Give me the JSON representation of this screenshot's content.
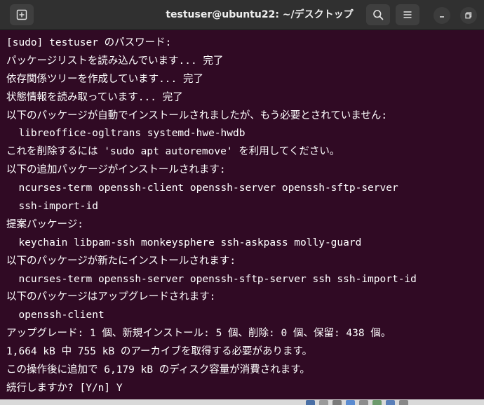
{
  "window": {
    "title": "testuser@ubuntu22: ~/デスクトップ"
  },
  "icons": {
    "new_tab": "new-tab-icon",
    "search": "search-icon",
    "menu": "hamburger-menu-icon",
    "minimize": "minimize-icon",
    "maximize": "maximize-icon"
  },
  "colors": {
    "terminal_bg": "#300a24",
    "header_bg": "#303030",
    "text": "#ffffff"
  },
  "terminal": {
    "lines": [
      "[sudo] testuser のパスワード:",
      "パッケージリストを読み込んでいます... 完了",
      "依存関係ツリーを作成しています... 完了",
      "状態情報を読み取っています... 完了",
      "以下のパッケージが自動でインストールされましたが、もう必要とされていません:",
      "  libreoffice-ogltrans systemd-hwe-hwdb",
      "これを削除するには 'sudo apt autoremove' を利用してください。",
      "以下の追加パッケージがインストールされます:",
      "  ncurses-term openssh-client openssh-server openssh-sftp-server",
      "  ssh-import-id",
      "提案パッケージ:",
      "  keychain libpam-ssh monkeysphere ssh-askpass molly-guard",
      "以下のパッケージが新たにインストールされます:",
      "  ncurses-term openssh-server openssh-sftp-server ssh ssh-import-id",
      "以下のパッケージはアップグレードされます:",
      "  openssh-client",
      "アップグレード: 1 個、新規インストール: 5 個、削除: 0 個、保留: 438 個。",
      "1,664 kB 中 755 kB のアーカイブを取得する必要があります。",
      "この操作後に追加で 6,179 kB のディスク容量が消費されます。",
      "続行しますか? [Y/n] Y"
    ]
  }
}
